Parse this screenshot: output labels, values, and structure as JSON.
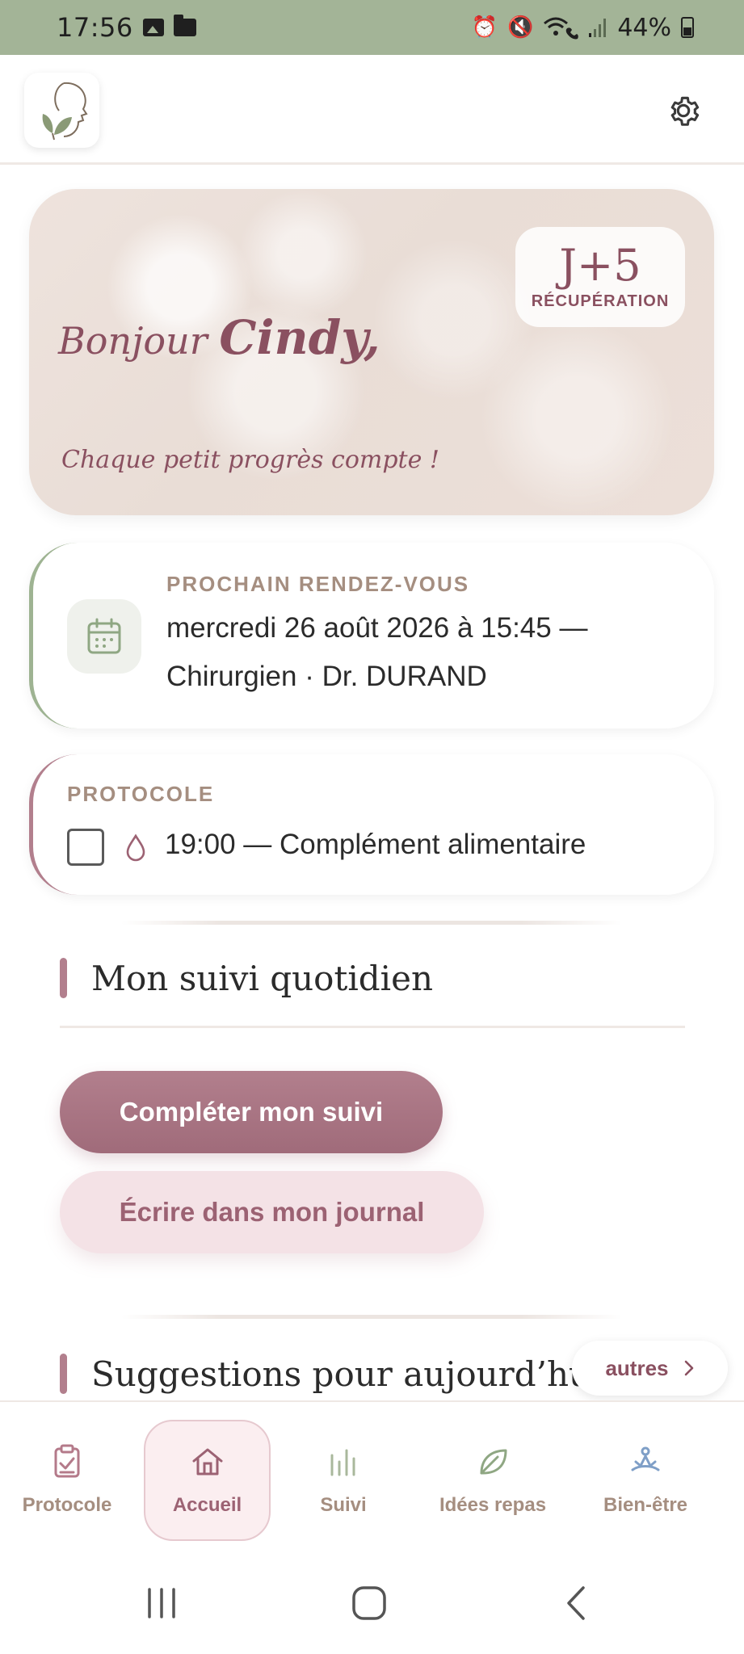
{
  "status_bar": {
    "time": "17:56",
    "battery": "44%",
    "icons": [
      "gallery-icon",
      "folder-icon",
      "alarm-icon",
      "mute-icon",
      "wifi-call-icon",
      "signal-icon",
      "battery-icon"
    ]
  },
  "header": {
    "logo": "leaf-face-logo",
    "settings_icon": "gear-icon"
  },
  "hero": {
    "greeting": "Bonjour",
    "name": "Cindy,",
    "motto": "Chaque petit progrès compte !",
    "badge_day": "J+5",
    "badge_label": "RÉCUPÉRATION"
  },
  "appointment": {
    "label": "PROCHAIN RENDEZ-VOUS",
    "line1": "mercredi 26 août 2026 à 15:45 —",
    "line2": "Chirurgien · Dr. DURAND",
    "icon": "calendar-icon"
  },
  "protocol": {
    "label": "PROTOCOLE",
    "item": "19:00 — Complément alimentaire",
    "checked": false,
    "icon": "drop-icon"
  },
  "daily": {
    "title": "Mon suivi quotidien",
    "primary_button": "Compléter mon suivi",
    "secondary_button": "Écrire dans mon journal"
  },
  "suggestions": {
    "title": "Suggestions pour aujourd’hui",
    "more_button": "autres"
  },
  "bottom_nav": {
    "items": [
      {
        "label": "Protocole",
        "icon": "clipboard-check-icon"
      },
      {
        "label": "Accueil",
        "icon": "home-icon",
        "active": true
      },
      {
        "label": "Suivi",
        "icon": "bar-chart-icon"
      },
      {
        "label": "Idées repas",
        "icon": "leaf-icon"
      },
      {
        "label": "Bien-être",
        "icon": "meditation-icon"
      }
    ]
  },
  "colors": {
    "status_bar": "#a3b497",
    "accent_rose": "#b27f8d",
    "accent_sage": "#9eb392",
    "text_rose": "#8a5060",
    "label_muted": "#a58e80"
  }
}
